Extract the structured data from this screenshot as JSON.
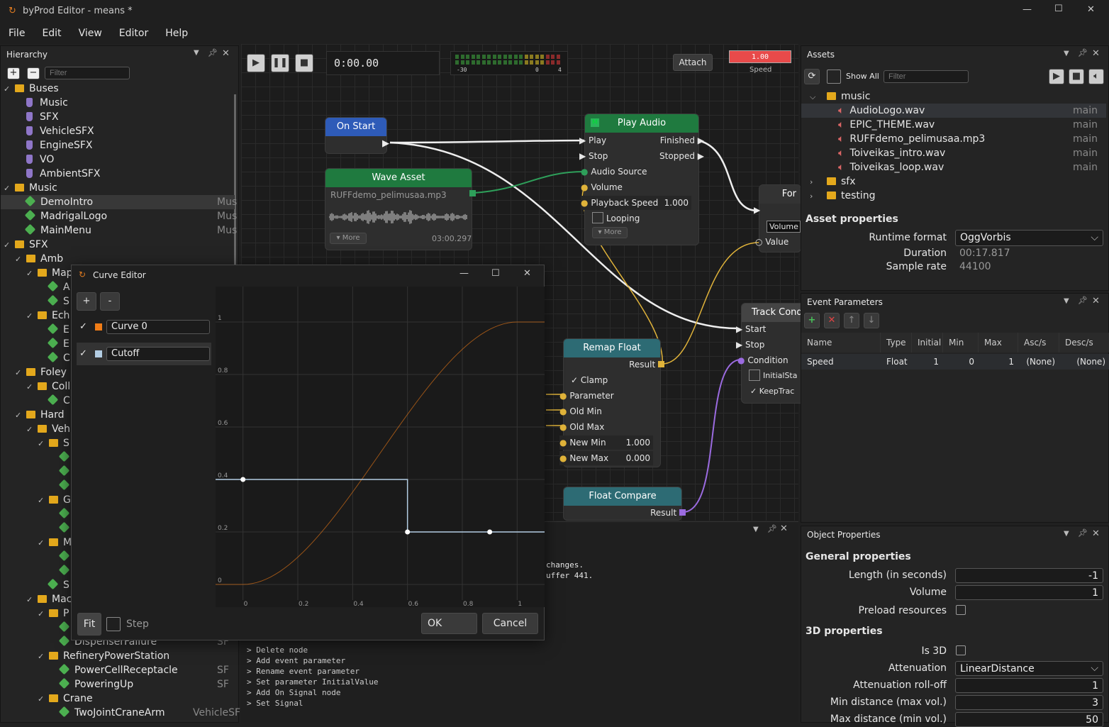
{
  "window": {
    "title": "byProd Editor - means *",
    "min": "—",
    "max": "☐",
    "close": "✕"
  },
  "menu": [
    "File",
    "Edit",
    "View",
    "Editor",
    "Help"
  ],
  "hierarchy": {
    "title": "Hierarchy",
    "filter_placeholder": "Filter",
    "items": [
      {
        "label": "Buses",
        "kind": "folder",
        "indent": 0,
        "exp": "v"
      },
      {
        "label": "Music",
        "kind": "bus",
        "indent": 1
      },
      {
        "label": "SFX",
        "kind": "bus",
        "indent": 1
      },
      {
        "label": "VehicleSFX",
        "kind": "bus",
        "indent": 1
      },
      {
        "label": "EngineSFX",
        "kind": "bus",
        "indent": 1
      },
      {
        "label": "VO",
        "kind": "bus",
        "indent": 1
      },
      {
        "label": "AmbientSFX",
        "kind": "bus",
        "indent": 1
      },
      {
        "label": "Music",
        "kind": "folder",
        "indent": 0,
        "exp": "v"
      },
      {
        "label": "DemoIntro",
        "kind": "event",
        "indent": 1,
        "bus": "Mus",
        "sel": true
      },
      {
        "label": "MadrigalLogo",
        "kind": "event",
        "indent": 1,
        "bus": "Mus"
      },
      {
        "label": "MainMenu",
        "kind": "event",
        "indent": 1,
        "bus": "Mus"
      },
      {
        "label": "SFX",
        "kind": "folder",
        "indent": 0,
        "exp": "v"
      },
      {
        "label": "Amb",
        "kind": "folder",
        "indent": 1,
        "exp": "v"
      },
      {
        "label": "Map",
        "kind": "folder",
        "indent": 2,
        "exp": "v"
      },
      {
        "label": "A",
        "kind": "event",
        "indent": 3
      },
      {
        "label": "S",
        "kind": "event",
        "indent": 3
      },
      {
        "label": "Ech",
        "kind": "folder",
        "indent": 2,
        "exp": "v"
      },
      {
        "label": "E",
        "kind": "event",
        "indent": 3
      },
      {
        "label": "E",
        "kind": "event",
        "indent": 3
      },
      {
        "label": "C",
        "kind": "event",
        "indent": 3
      },
      {
        "label": "Foley",
        "kind": "folder",
        "indent": 1,
        "exp": "v"
      },
      {
        "label": "Coll",
        "kind": "folder",
        "indent": 2,
        "exp": "v"
      },
      {
        "label": "C",
        "kind": "event",
        "indent": 3
      },
      {
        "label": "Hard",
        "kind": "folder",
        "indent": 1,
        "exp": "v"
      },
      {
        "label": "Veh",
        "kind": "folder",
        "indent": 2,
        "exp": "v"
      },
      {
        "label": "S",
        "kind": "folder",
        "indent": 3,
        "exp": "v"
      },
      {
        "label": "",
        "kind": "event",
        "indent": 4
      },
      {
        "label": "",
        "kind": "event",
        "indent": 4
      },
      {
        "label": "",
        "kind": "event",
        "indent": 4
      },
      {
        "label": "G",
        "kind": "folder",
        "indent": 3,
        "exp": "v"
      },
      {
        "label": "",
        "kind": "event",
        "indent": 4
      },
      {
        "label": "",
        "kind": "event",
        "indent": 4
      },
      {
        "label": "M",
        "kind": "folder",
        "indent": 3,
        "exp": "v"
      },
      {
        "label": "",
        "kind": "event",
        "indent": 4
      },
      {
        "label": "",
        "kind": "event",
        "indent": 4
      },
      {
        "label": "S",
        "kind": "event",
        "indent": 3
      },
      {
        "label": "Mac",
        "kind": "folder",
        "indent": 2,
        "exp": "v"
      },
      {
        "label": "P",
        "kind": "folder",
        "indent": 3,
        "exp": "v"
      },
      {
        "label": "",
        "kind": "event",
        "indent": 4
      },
      {
        "label": "DispenserFailure",
        "kind": "event",
        "indent": 4,
        "bus": "SF"
      },
      {
        "label": "RefineryPowerStation",
        "kind": "folder",
        "indent": 3,
        "exp": "v"
      },
      {
        "label": "PowerCellReceptacle",
        "kind": "event",
        "indent": 4,
        "bus": "SF"
      },
      {
        "label": "PoweringUp",
        "kind": "event",
        "indent": 4,
        "bus": "SF"
      },
      {
        "label": "Crane",
        "kind": "folder",
        "indent": 3,
        "exp": "v"
      },
      {
        "label": "TwoJointCraneArm",
        "kind": "event",
        "indent": 4,
        "bus": "VehicleSF"
      }
    ]
  },
  "transport": {
    "time": "0:00.00",
    "meter_labels": [
      "-30",
      "0",
      "4"
    ],
    "attach": "Attach",
    "speed_value": "1.00",
    "speed_label": "Speed"
  },
  "nodes": {
    "on_start": {
      "title": "On Start"
    },
    "wave_asset": {
      "title": "Wave Asset",
      "file": "RUFFdemo_pelimusaa.mp3",
      "more": "More",
      "duration": "03:00.297"
    },
    "play_audio": {
      "title": "Play Audio",
      "badge": "M",
      "play": "Play",
      "stop": "Stop",
      "finished": "Finished",
      "stopped": "Stopped",
      "audio_source": "Audio Source",
      "volume": "Volume",
      "playback_speed": "Playback Speed",
      "playback_value": "1.000",
      "looping": "Looping",
      "more": "More"
    },
    "for_node": {
      "title": "For",
      "volume": "Volume",
      "value": "Value"
    },
    "remap": {
      "title": "Remap Float",
      "result": "Result",
      "clamp": "Clamp",
      "parameter": "Parameter",
      "old_min": "Old Min",
      "old_max": "Old Max",
      "new_min": "New Min",
      "new_min_val": "1.000",
      "new_max": "New Max",
      "new_max_val": "0.000"
    },
    "float_compare": {
      "title": "Float Compare",
      "result": "Result"
    },
    "track_cond": {
      "title": "Track Cond",
      "start": "Start",
      "stop": "Stop",
      "condition": "Condition",
      "initial": "InitialSta",
      "keep": "KeepTrac"
    }
  },
  "log": {
    "lines": [
      "changes.",
      "uffer 441.",
      "Delete node",
      "Add event parameter",
      "Rename event parameter",
      "Set parameter InitialValue",
      "Add On Signal node",
      "Set Signal"
    ]
  },
  "curve_editor": {
    "title": "Curve Editor",
    "add": "+",
    "remove": "-",
    "curves": [
      {
        "name": "Curve 0",
        "color": "#f07c16"
      },
      {
        "name": "Cutoff",
        "color": "#b3cde3"
      }
    ],
    "y_ticks": [
      "1",
      "0.8",
      "0.6",
      "0.4",
      "0.2",
      "0"
    ],
    "x_ticks": [
      "0",
      "0.2",
      "0.4",
      "0.6",
      "0.8",
      "1"
    ],
    "fit": "Fit",
    "step": "Step",
    "ok": "OK",
    "cancel": "Cancel"
  },
  "chart_data": {
    "type": "line",
    "x": [
      0,
      0.2,
      0.4,
      0.6,
      0.8,
      1
    ],
    "xlim": [
      -0.1,
      1.1
    ],
    "ylim": [
      0,
      1
    ],
    "series": [
      {
        "name": "Curve 0",
        "points": [
          [
            0,
            0
          ],
          [
            0.5,
            0.5
          ],
          [
            1,
            1
          ]
        ]
      },
      {
        "name": "Cutoff",
        "points": [
          [
            0,
            0.4
          ],
          [
            0.6,
            0.4
          ],
          [
            0.6,
            0.2
          ],
          [
            1,
            0.2
          ]
        ]
      }
    ]
  },
  "assets": {
    "title": "Assets",
    "show_all": "Show All",
    "filter_placeholder": "Filter",
    "tree": [
      {
        "label": "music",
        "kind": "folder",
        "exp": "v",
        "indent": 0
      },
      {
        "label": "AudioLogo.wav",
        "kind": "audio",
        "indent": 1,
        "tag": "main",
        "sel": true
      },
      {
        "label": "EPIC_THEME.wav",
        "kind": "audio",
        "indent": 1,
        "tag": "main"
      },
      {
        "label": "RUFFdemo_pelimusaa.mp3",
        "kind": "audio",
        "indent": 1,
        "tag": "main"
      },
      {
        "label": "Toiveikas_intro.wav",
        "kind": "audio",
        "indent": 1,
        "tag": "main"
      },
      {
        "label": "Toiveikas_loop.wav",
        "kind": "audio",
        "indent": 1,
        "tag": "main"
      },
      {
        "label": "sfx",
        "kind": "folder",
        "exp": ">",
        "indent": 0
      },
      {
        "label": "testing",
        "kind": "folder",
        "exp": ">",
        "indent": 0
      }
    ]
  },
  "asset_properties": {
    "title": "Asset properties",
    "runtime_label": "Runtime format",
    "runtime_value": "OggVorbis",
    "duration_label": "Duration",
    "duration_value": "00:17.817",
    "rate_label": "Sample rate",
    "rate_value": "44100"
  },
  "event_params": {
    "title": "Event Parameters",
    "headers": [
      "Name",
      "Type",
      "Initial",
      "Min",
      "Max",
      "Asc/s",
      "Desc/s"
    ],
    "rows": [
      [
        "Speed",
        "Float",
        "1",
        "0",
        "1",
        "(None)",
        "(None)"
      ]
    ]
  },
  "object_props": {
    "title": "Object Properties",
    "general": "General properties",
    "length_label": "Length (in seconds)",
    "length_value": "-1",
    "volume_label": "Volume",
    "volume_value": "1",
    "preload_label": "Preload resources",
    "props3d": "3D properties",
    "is3d_label": "Is 3D",
    "atten_label": "Attenuation",
    "atten_value": "LinearDistance",
    "rolloff_label": "Attenuation roll-off",
    "rolloff_value": "1",
    "min_label": "Min distance (max vol.)",
    "min_value": "3",
    "max_label": "Max distance (min vol.)",
    "max_value": "50"
  }
}
